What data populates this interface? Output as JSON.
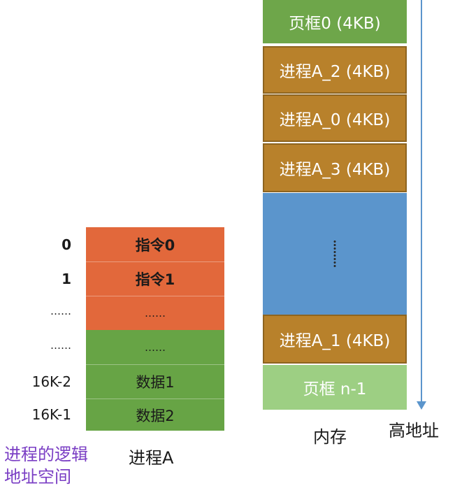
{
  "memory": {
    "blocks": [
      {
        "label": "页框0 (4KB)"
      },
      {
        "label": "进程A_2 (4KB)"
      },
      {
        "label": "进程A_0 (4KB)"
      },
      {
        "label": "进程A_3 (4KB)"
      },
      {
        "label": "⋮"
      },
      {
        "label": "进程A_1 (4KB)"
      },
      {
        "label": "页框 n-1"
      }
    ],
    "caption": "内存",
    "arrow_label": "高地址"
  },
  "process": {
    "rows": [
      {
        "addr": "0",
        "content": "指令0"
      },
      {
        "addr": "1",
        "content": "指令1"
      },
      {
        "addr": "……",
        "content": "……"
      },
      {
        "addr": "……",
        "content": "……"
      },
      {
        "addr": "16K-2",
        "content": "数据1"
      },
      {
        "addr": "16K-1",
        "content": "数据2"
      }
    ],
    "caption": "进程A",
    "side_caption_line1": "进程的逻辑",
    "side_caption_line2": "地址空间"
  },
  "colors": {
    "frame_green": "#6ea64a",
    "process_brown": "#b8812b",
    "gap_blue": "#5b95cc",
    "frame_light": "#9dcf83",
    "instr_orange": "#e2683b",
    "data_green": "#67a445",
    "caption_purple": "#7a3ec4"
  }
}
